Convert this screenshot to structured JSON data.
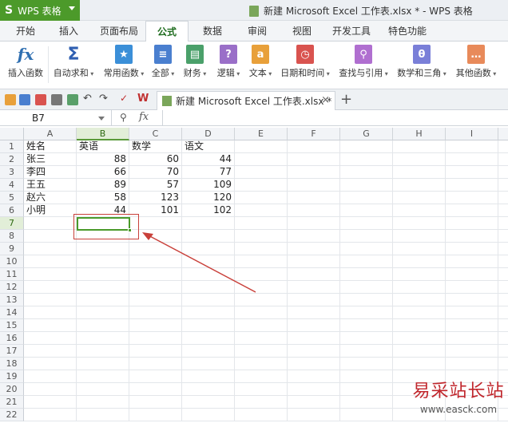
{
  "app": {
    "name": "WPS 表格",
    "logo_glyph": "S",
    "window_title": "新建 Microsoft Excel 工作表.xlsx * - WPS 表格"
  },
  "colors": {
    "brand_green": "#4c9a2a",
    "annotation_red": "#c9403a",
    "selection_green": "#4a9a2a"
  },
  "tabs": [
    {
      "label": "开始"
    },
    {
      "label": "插入"
    },
    {
      "label": "页面布局"
    },
    {
      "label": "公式",
      "active": true
    },
    {
      "label": "数据"
    },
    {
      "label": "审阅"
    },
    {
      "label": "视图"
    },
    {
      "label": "开发工具"
    },
    {
      "label": "特色功能"
    }
  ],
  "ribbon": {
    "insert_fn": {
      "label": "插入函数",
      "icon": "fx-icon"
    },
    "autosum": {
      "label": "自动求和",
      "icon": "sigma-icon"
    },
    "common": {
      "label": "常用函数",
      "icon": "star-icon"
    },
    "all": {
      "label": "全部",
      "icon": "list-book-icon"
    },
    "finance": {
      "label": "财务",
      "icon": "finance-book-icon"
    },
    "logic": {
      "label": "逻辑",
      "icon": "question-book-icon"
    },
    "text": {
      "label": "文本",
      "icon": "text-book-icon"
    },
    "datetime": {
      "label": "日期和时间",
      "icon": "clock-book-icon"
    },
    "lookup": {
      "label": "查找与引用",
      "icon": "search-book-icon"
    },
    "math": {
      "label": "数学和三角",
      "icon": "theta-book-icon"
    },
    "other": {
      "label": "其他函数",
      "icon": "dots-book-icon"
    }
  },
  "doc_tab": {
    "label": "新建 Microsoft Excel 工作表.xlsx *",
    "close": "×",
    "new_tab": "+"
  },
  "formula_bar": {
    "name_box": "B7",
    "fx": "fx",
    "search_glyph": "⚲",
    "value": ""
  },
  "sheet": {
    "columns": [
      "A",
      "B",
      "C",
      "D",
      "E",
      "F",
      "G",
      "H",
      "I"
    ],
    "rows": [
      "1",
      "2",
      "3",
      "4",
      "5",
      "6",
      "7",
      "8",
      "9",
      "10",
      "11",
      "12",
      "13",
      "14",
      "15",
      "16",
      "17",
      "18",
      "19",
      "20",
      "21",
      "22"
    ],
    "data": [
      [
        "姓名",
        "英语",
        "数学",
        "语文"
      ],
      [
        "张三",
        "88",
        "60",
        "44"
      ],
      [
        "李四",
        "66",
        "70",
        "77"
      ],
      [
        "王五",
        "89",
        "57",
        "109"
      ],
      [
        "赵六",
        "58",
        "123",
        "120"
      ],
      [
        "小明",
        "44",
        "101",
        "102"
      ]
    ],
    "selected_cell": "B7"
  },
  "watermark": {
    "cn": "易采站长站",
    "en": "www.easck.com"
  }
}
